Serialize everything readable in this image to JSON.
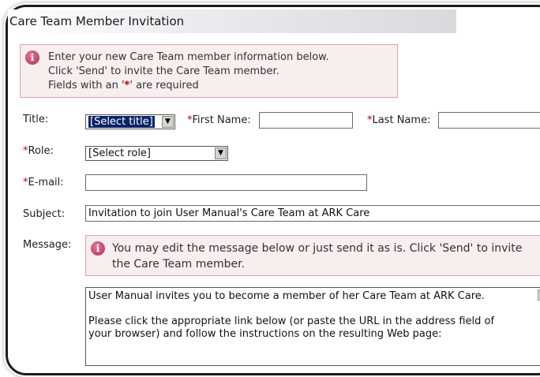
{
  "header": {
    "title": "Care Team Member Invitation"
  },
  "info": {
    "line1": "Enter your new Care Team member information below.",
    "line2": "Click 'Send' to invite the Care Team member.",
    "line3_prefix": "Fields with an '",
    "line3_star": "*",
    "line3_suffix": "' are required"
  },
  "form": {
    "required_mark": "*",
    "title_label": "Title:",
    "title_value": "[Select title]",
    "first_name_label": "First Name:",
    "first_name_value": "",
    "last_name_label": "Last Name:",
    "last_name_value": "",
    "role_label": "Role:",
    "role_value": "[Select role]",
    "email_label": "E-mail:",
    "email_value": "",
    "subject_label": "Subject:",
    "subject_value": "Invitation to join User Manual's Care Team at ARK Care",
    "message_label": "Message:",
    "message_note_line1": "You may edit the message below or just send it as is. Click 'Send' to invite",
    "message_note_line2": "the Care Team member.",
    "message_line1": "User Manual invites you to become a member of her Care Team at ARK Care.",
    "message_line2": "Please click the appropriate link below (or paste the URL in the address field of",
    "message_line3": "your browser) and follow the instructions on the resulting Web page:"
  },
  "icons": {
    "info": "info-icon",
    "dropdown": "chevron-down-icon",
    "scroll_up": "scroll-up-arrow-icon"
  },
  "colors": {
    "required": "#c00000",
    "info_bg": "#f7eeee",
    "info_border": "#e0a5a5",
    "info_icon": "#c0396a",
    "selection": "#0a246a"
  }
}
